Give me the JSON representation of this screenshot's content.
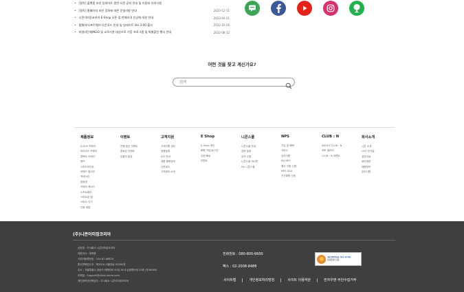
{
  "notices": [
    {
      "title": "[필독] 플랫폼 보안 업데이트 관련 사전 공지 안내 및 이용자 유의사항",
      "date": ""
    },
    {
      "title": "[필독] 홈페이지 보안 강화에 따른 운영사항 안내",
      "date": "2023-12-11"
    },
    {
      "title": "니콘이미징코리아 E-Shop 오픈 및 판매가격 인상에 대한 안내",
      "date": "2023-04-21"
    },
    {
      "title": "펌웨어/소프트웨어 다운로드 안내 및 업데이트 Ver.3.00 출시",
      "date": "2022-10-26"
    },
    {
      "title": "비영리단체/NGO 및 교육기관 대상으로 기증 프로그램 및 특별할인 행사 안내",
      "date": "2022-08-12"
    }
  ],
  "social": [
    {
      "name": "talk",
      "color": "#3aa655"
    },
    {
      "name": "facebook",
      "color": "#3b5998"
    },
    {
      "name": "youtube",
      "color": "#e62117"
    },
    {
      "name": "instagram",
      "color": "#d6306f"
    },
    {
      "name": "naver-blog",
      "color": "#23b14d"
    }
  ],
  "search": {
    "heading": "어떤 것을 찾고 계신가요?",
    "placeholder": "검색"
  },
  "sitemap": [
    {
      "title": "제품정보",
      "items": [
        "D-SLR 카메라",
        "미러리스 카메라",
        "콤팩트 카메라",
        "렌즈",
        "스피드라이트",
        "커맨드 릴리즈",
        "액세서리",
        "망원경",
        "카메라 케이스",
        "소프트웨어",
        "스마트폰 앱",
        "스마트 기기",
        "단종 제품"
      ]
    },
    {
      "title": "이벤트",
      "items": [
        "진행 중인 이벤트",
        "종료된 이벤트",
        "당첨자 발표"
      ]
    },
    {
      "title": "고객지원",
      "items": [
        "고객지원 센터",
        "정품등록",
        "A/S 안내",
        "제품 활용정보",
        "다운로드",
        "고객센터 소개"
      ]
    },
    {
      "title": "E Shop",
      "items": [
        "E-Shop 메인",
        "회원 가입/로그인",
        "주문/배송",
        "이벤트"
      ]
    },
    {
      "title": "니콘스쿨",
      "items": [
        "니콘스쿨 안내",
        "강좌 일정",
        "강의 신청",
        "니콘스쿨 게시판",
        "My 니콘스쿨"
      ]
    },
    {
      "title": "NPS",
      "items": [
        "가입 및 혜택",
        "서비스",
        "공지사항",
        "My NPS",
        "행사 지원 신청",
        "NPS Q&A",
        "신규회원 신청"
      ]
    },
    {
      "title": "CLUB : N",
      "items": [
        "ABOUT CLUB : N",
        "포토 갤러리",
        "CLUB : N 이벤트"
      ]
    },
    {
      "title": "회사소개",
      "items": [
        "니콘 소개",
        "CEO 인사말",
        "경영이념",
        "윤리경영",
        "채용정보",
        "공지사항"
      ]
    }
  ],
  "footer": {
    "brand": "(주)니콘이미징코리아",
    "info": [
      "상호명 : 주식회사 니콘이미징코리아",
      "대표이사 : 정재웅",
      "사업자등록번호 : 104-81-86829",
      "통신판매업신고 : 제2016-서울강남-00000호",
      "주소 : 서울특별시 강남구 테헤란로 87길 36 도심공항타워 22층 (우06164)",
      "이메일 : Support@nikon-korea.com",
      "개인정보관리책임자 : 주식회사 니콘이미징코리아"
    ],
    "phone": "전화번호 : 080-800-6600",
    "fax": "팩스 : 02-2008-8488",
    "badge_title": "개인정보보호 우수 사이트",
    "badge_sub": "정보보호 인증",
    "links": [
      "사이트맵",
      "개인정보처리방침",
      "사이트 이용약관",
      "전자우편 무단수집거부"
    ]
  }
}
